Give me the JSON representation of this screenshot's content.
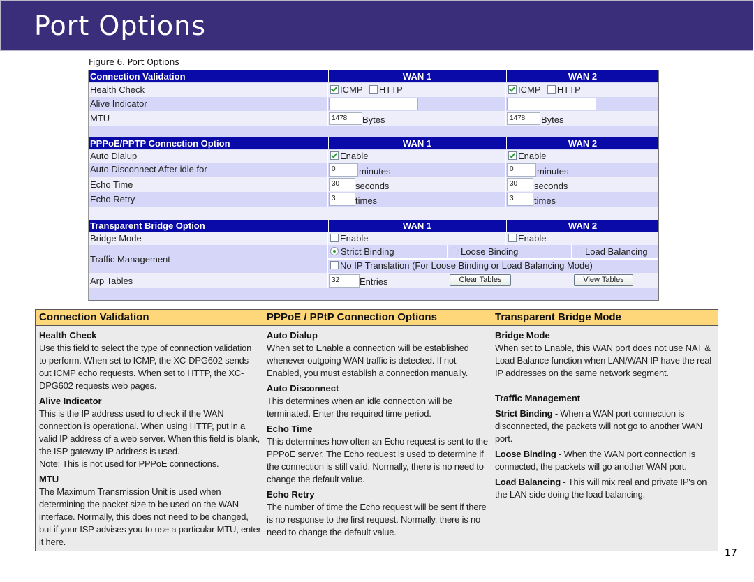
{
  "page": {
    "title": "Port Options",
    "figure_caption": "Figure 6.  Port Options",
    "page_number": "17"
  },
  "screenshot": {
    "wan_headers": [
      "WAN 1",
      "WAN 2"
    ],
    "connection_validation": {
      "section_title": "Connection Validation",
      "health_check": {
        "label": "Health Check",
        "options": [
          "ICMP",
          "HTTP"
        ],
        "wan1": {
          "icmp": true,
          "http": false
        },
        "wan2": {
          "icmp": true,
          "http": false
        }
      },
      "alive_indicator": {
        "label": "Alive Indicator",
        "wan1": "",
        "wan2": ""
      },
      "mtu": {
        "label": "MTU",
        "wan1": "1478",
        "wan2": "1478",
        "unit": "Bytes"
      }
    },
    "pppoe": {
      "section_title": "PPPoE/PPTP Connection Option",
      "auto_dialup": {
        "label": "Auto Dialup",
        "option": "Enable",
        "wan1": true,
        "wan2": true
      },
      "auto_disconnect": {
        "label": "Auto Disconnect After idle for",
        "wan1": "0",
        "wan2": "0",
        "unit": "minutes"
      },
      "echo_time": {
        "label": "Echo Time",
        "wan1": "30",
        "wan2": "30",
        "unit": "seconds"
      },
      "echo_retry": {
        "label": "Echo Retry",
        "wan1": "3",
        "wan2": "3",
        "unit": "times"
      }
    },
    "bridge": {
      "section_title": "Transparent Bridge Option",
      "bridge_mode": {
        "label": "Bridge Mode",
        "option": "Enable",
        "wan1": false,
        "wan2": false
      },
      "traffic_management": {
        "label": "Traffic Management",
        "options": [
          "Strict Binding",
          "Loose Binding",
          "Load Balancing"
        ],
        "selected": "Strict Binding",
        "no_ip_translation": {
          "label": "No IP Translation (For Loose Binding or Load Balancing Mode)",
          "checked": false
        }
      },
      "arp_tables": {
        "label": "Arp Tables",
        "value": "32",
        "unit": "Entries",
        "clear_button": "Clear Tables",
        "view_button": "View Tables"
      }
    }
  },
  "descriptions": {
    "columns": [
      {
        "title": "Connection Validation",
        "items": [
          {
            "heading": "Health Check",
            "text": "Use this field to select the type of connection validation to perform. When set to ICMP, the XC-DPG602 sends out ICMP echo requests.  When set to HTTP, the XC-DPG602 requests web pages."
          },
          {
            "heading": "Alive Indicator",
            "text": "This is the IP address used to check if the WAN connection is operational. When using HTTP, put in a valid IP address of a web server. When this field is blank, the ISP gateway IP address is used.",
            "note": "Note: This is not used for PPPoE connections."
          },
          {
            "heading": "MTU",
            "text": "The Maximum Transmission Unit is used when determining the packet size to be used on the WAN interface. Normally, this does not need to be changed, but if your ISP advises you to use a particular MTU, enter it here."
          }
        ]
      },
      {
        "title": "PPPoE / PPtP Connection Options",
        "items": [
          {
            "heading": "Auto Dialup",
            "text": "When set to Enable a connection will be established whenever outgoing WAN traffic is detected. If not Enabled, you must establish a connection manually."
          },
          {
            "heading": "Auto Disconnect",
            "text": "This determines when an idle connection will be terminated. Enter the required time period."
          },
          {
            "heading": "Echo Time",
            "text": "This determines how often an Echo request is sent to the PPPoE server. The Echo request is used to determine if the connection is still valid. Normally, there is no need to change the default value."
          },
          {
            "heading": "Echo Retry",
            "text": "The number of time the Echo request will be sent if there is no response to the first request. Normally, there is no need to change the default value."
          }
        ]
      },
      {
        "title": "Transparent Bridge Mode",
        "items": [
          {
            "heading": "Bridge Mode",
            "text": "When set to Enable, this WAN port does not use NAT & Load Balance function when LAN/WAN IP have the real IP addresses on the same network segment."
          },
          {
            "heading": "Traffic Management"
          },
          {
            "term": "Strict Binding",
            "text": " - When a WAN port connection is disconnected, the packets will not go to another WAN port."
          },
          {
            "term": "Loose Binding",
            "text": " - When the WAN port connection is connected, the packets will go another WAN port."
          },
          {
            "term": "Load Balancing",
            "text": " - This will mix real and private IP's on the LAN side doing the load balancing."
          }
        ]
      }
    ]
  },
  "colors": {
    "banner": "#3a2e7a",
    "section_header": "#0a0aa8",
    "row_light": "#eeeefb",
    "row_dark": "#d6d6f8",
    "desc_header": "#fdd77a",
    "desc_body": "#ebebeb"
  }
}
